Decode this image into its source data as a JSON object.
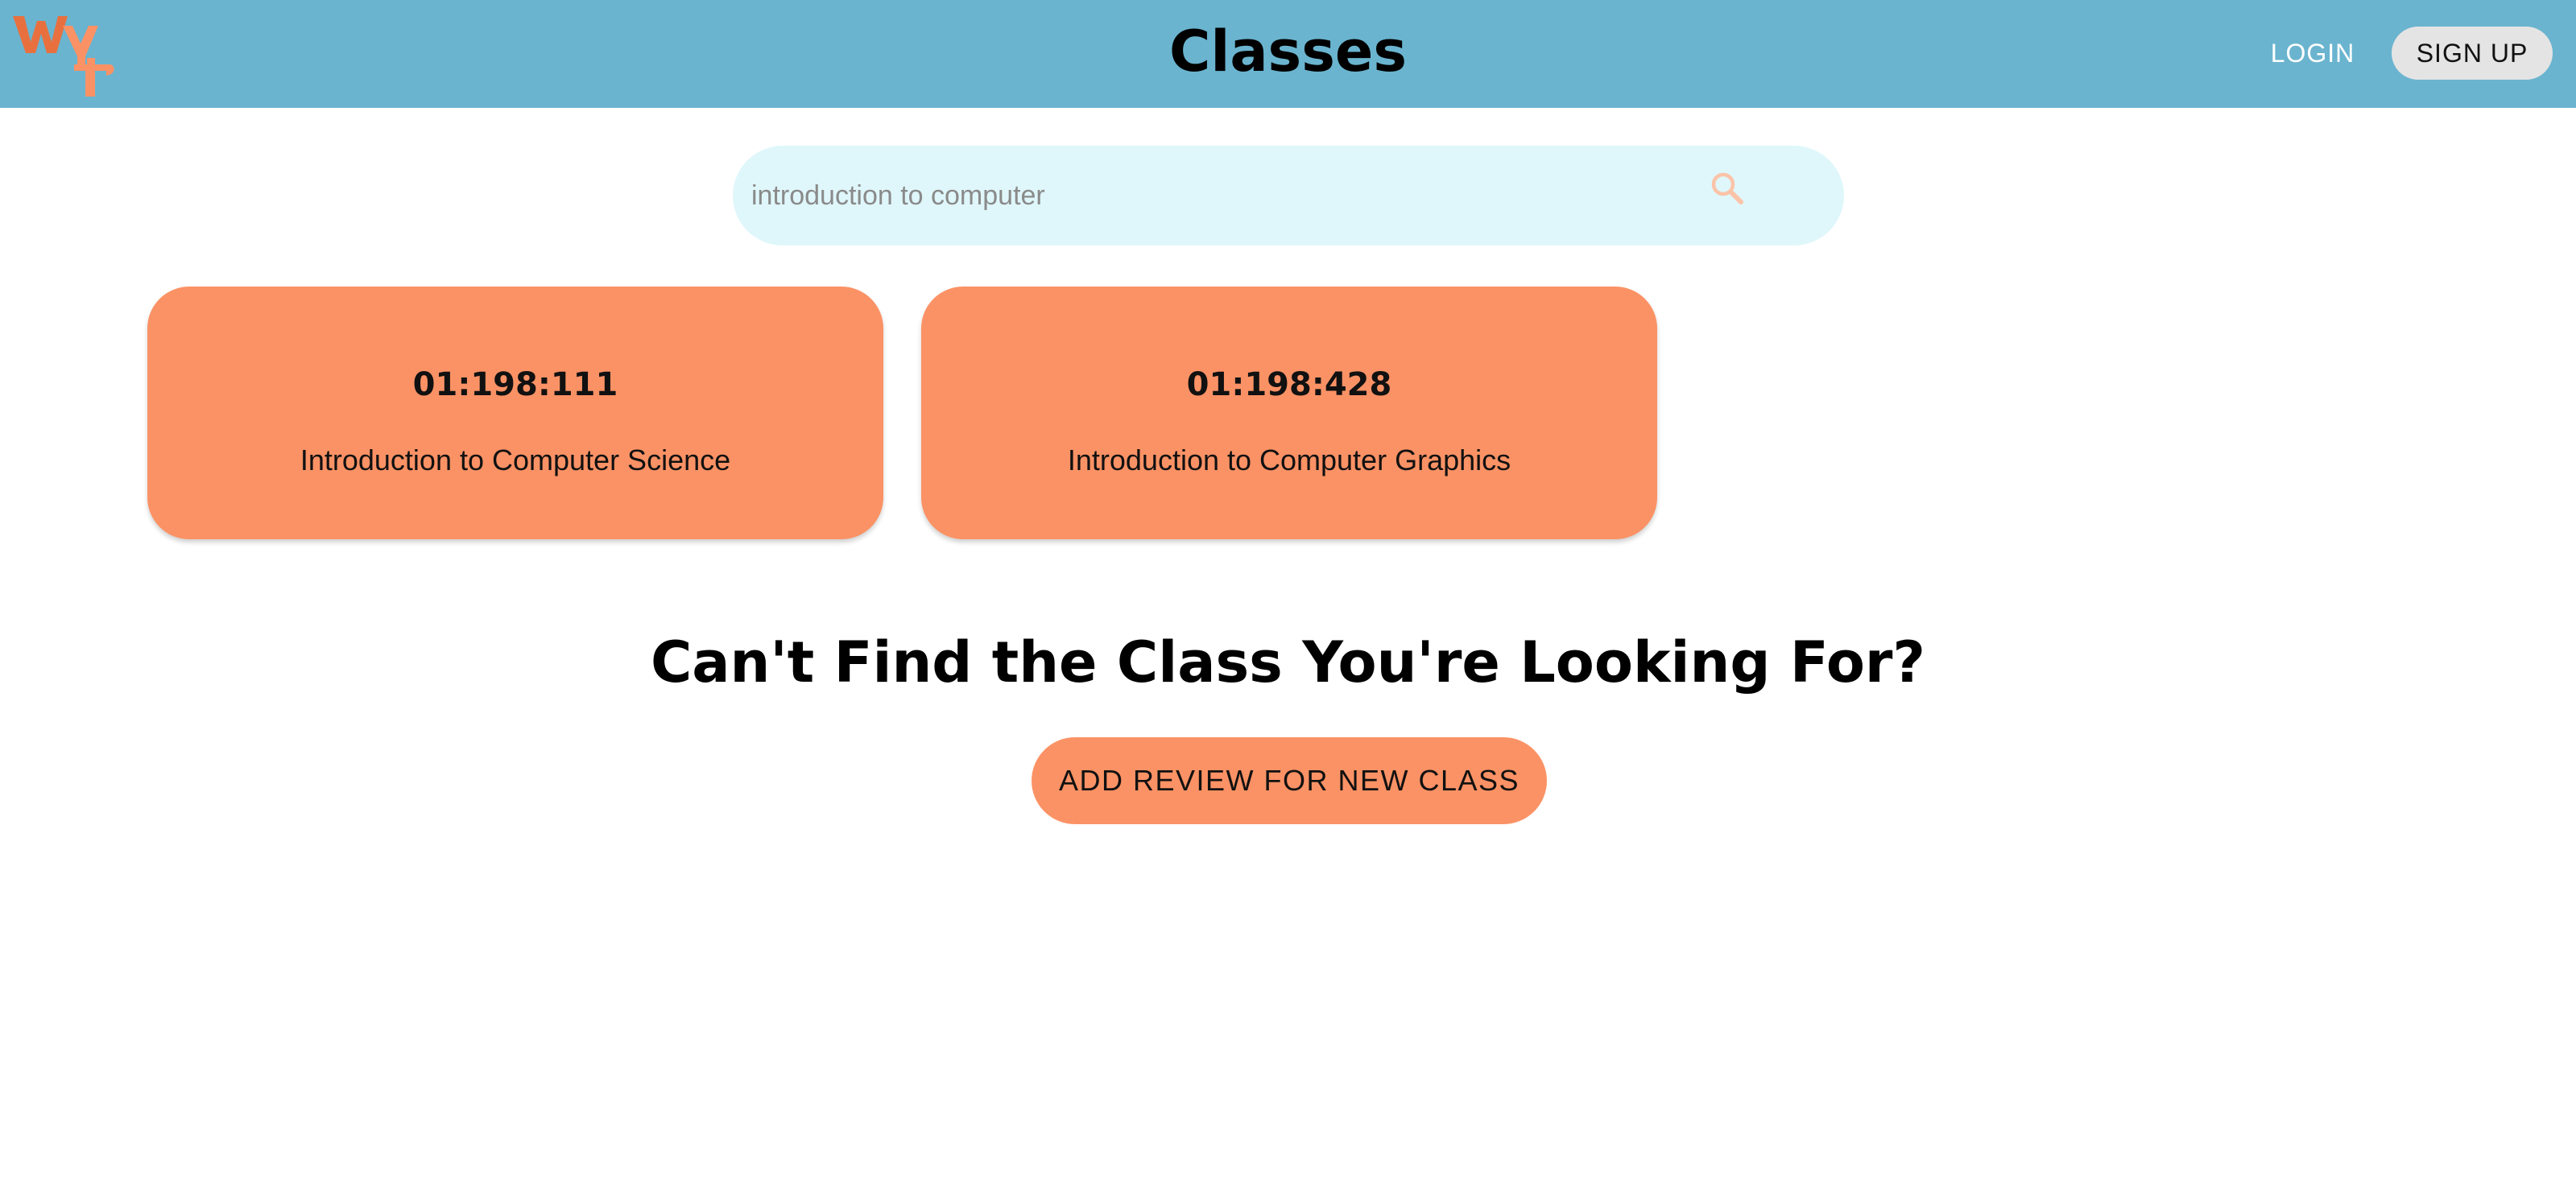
{
  "app": {
    "logo_text": "wyt"
  },
  "header": {
    "title": "Classes",
    "login_label": "LOGIN",
    "signup_label": "SIGN UP"
  },
  "search": {
    "value": "introduction to computer",
    "icon": "search-icon"
  },
  "results": [
    {
      "code": "01:198:111",
      "name": "Introduction to Computer Science"
    },
    {
      "code": "01:198:428",
      "name": "Introduction to Computer Graphics"
    }
  ],
  "cta": {
    "heading": "Can't Find the Class You're Looking For?",
    "button_label": "ADD REVIEW FOR NEW CLASS"
  },
  "colors": {
    "header_bg": "#6ab4cf",
    "accent": "#fb9265",
    "search_bg": "#dff7fb",
    "logo_dark": "#e8703f",
    "logo_light": "#fb9265"
  }
}
